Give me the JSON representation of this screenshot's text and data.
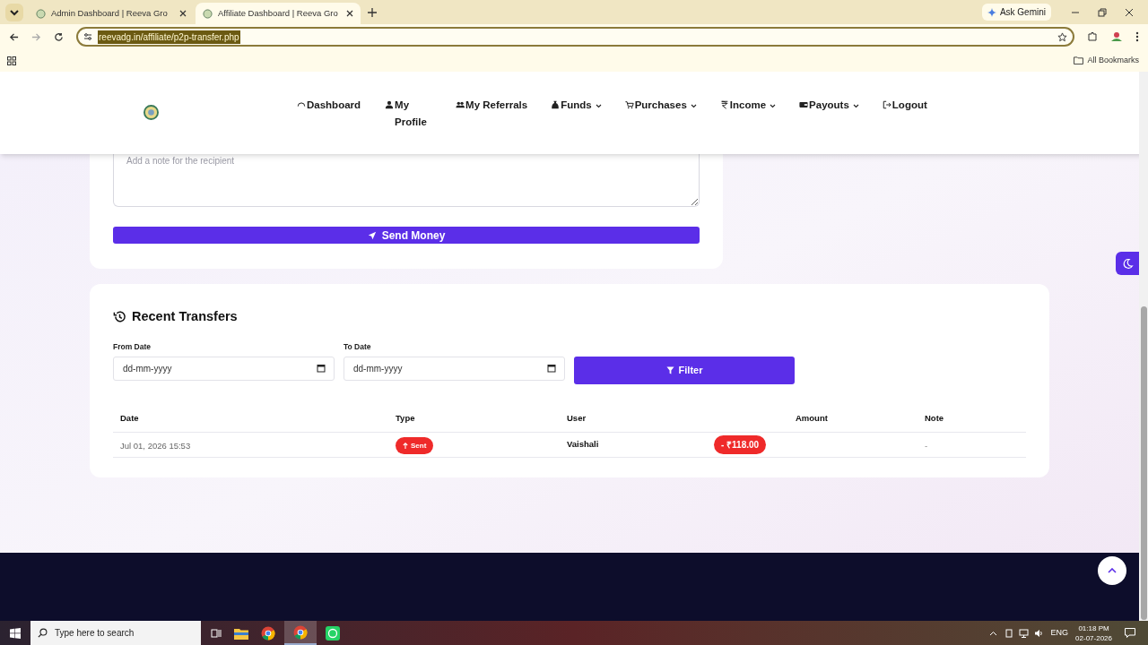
{
  "browser": {
    "tabs": [
      {
        "title": "Admin Dashboard | Reeva Gro",
        "selected": false
      },
      {
        "title": "Affiliate Dashboard | Reeva Gro",
        "selected": true
      }
    ],
    "ask_gemini": "Ask Gemini",
    "url": "reevadg.in/affiliate/p2p-transfer.php",
    "bookmarks": "All Bookmarks"
  },
  "nav": {
    "items": [
      {
        "label": "Dashboard",
        "has_menu": false
      },
      {
        "label": "My Profile",
        "has_menu": false
      },
      {
        "label": "My Referrals",
        "has_menu": false
      },
      {
        "label": "Funds",
        "has_menu": true
      },
      {
        "label": "Purchases",
        "has_menu": true
      },
      {
        "label": "Income",
        "has_menu": true
      },
      {
        "label": "Payouts",
        "has_menu": true
      },
      {
        "label": "Logout",
        "has_menu": false
      }
    ]
  },
  "transfer_form": {
    "note_placeholder": "Add a note for the recipient",
    "send_button": "Send Money"
  },
  "recent_transfers": {
    "title": "Recent Transfers",
    "from_label": "From Date",
    "from_placeholder": "dd-mm-yyyy",
    "to_label": "To Date",
    "to_placeholder": "dd-mm-yyyy",
    "filter_button": "Filter",
    "columns": [
      "Date",
      "Type",
      "User",
      "Amount",
      "Note"
    ],
    "rows": [
      {
        "date": "Jul 01, 2026 15:53",
        "type": "Sent",
        "user": "Vaishali",
        "amount": "- ₹118.00",
        "note": "-"
      }
    ]
  },
  "taskbar": {
    "search_placeholder": "Type here to search",
    "language": "ENG",
    "time": "01:18 PM",
    "date": "02-07-2026"
  }
}
